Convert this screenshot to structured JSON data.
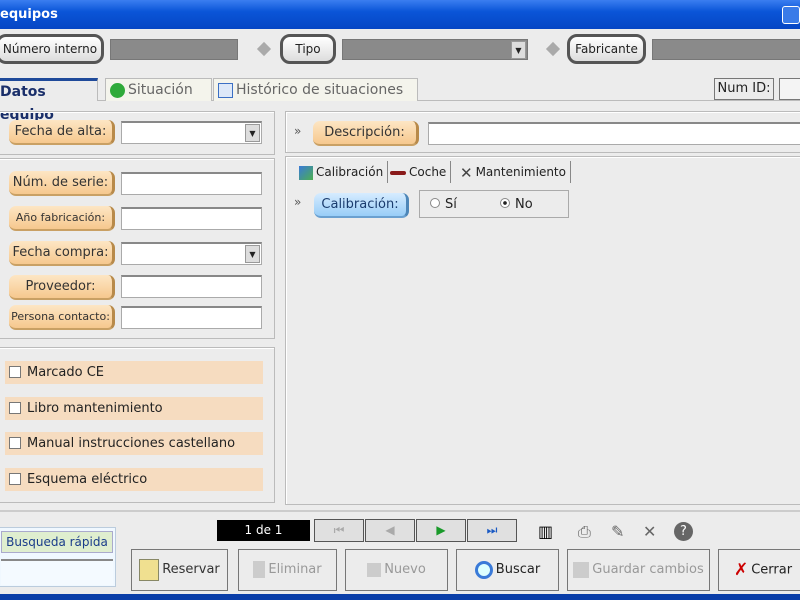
{
  "window": {
    "title": "equipos"
  },
  "search_bar": {
    "numero_interno": "Número interno",
    "tipo": "Tipo",
    "fabricante": "Fabricante"
  },
  "tabs": [
    {
      "label": "Datos equipo",
      "active": true
    },
    {
      "label": "Situación"
    },
    {
      "label": "Histórico de situaciones"
    }
  ],
  "num_id": {
    "label": "Num ID:",
    "value": ""
  },
  "left": {
    "fecha_alta": "Fecha de alta:",
    "fields": [
      "Núm. de serie:",
      "Año fabricación:",
      "Fecha compra:",
      "Proveedor:",
      "Persona contacto:"
    ],
    "checkboxes": [
      {
        "label": "Marcado CE",
        "checked": false
      },
      {
        "label": "Libro mantenimiento",
        "checked": false
      },
      {
        "label": "Manual instrucciones castellano",
        "checked": false
      },
      {
        "label": "Esquema eléctrico",
        "checked": false
      }
    ]
  },
  "right": {
    "descripcion": "Descripción:",
    "subtabs": [
      "Calibración",
      "Coche",
      "Mantenimiento"
    ],
    "calibracion": {
      "label": "Calibración:",
      "options": [
        "Sí",
        "No"
      ],
      "selected": "No"
    }
  },
  "bottom": {
    "busqueda": "Busqueda rápida",
    "record": "1 de 1",
    "buttons": {
      "reservar": "Reservar",
      "eliminar": "Eliminar",
      "nuevo": "Nuevo",
      "buscar": "Buscar",
      "guardar": "Guardar cambios",
      "cerrar": "Cerrar"
    }
  },
  "colors": {
    "titlebar": "#0a55d8",
    "label_orange": "#f6c88e",
    "label_blue": "#98cdf7"
  }
}
